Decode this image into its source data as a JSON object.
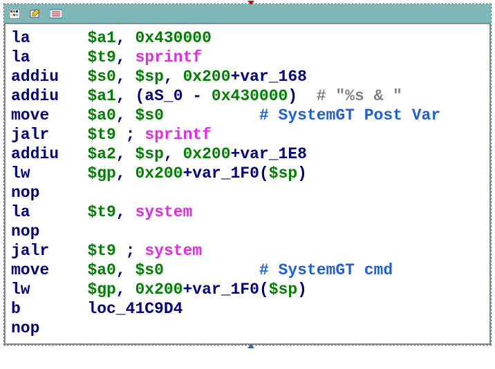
{
  "icons": [
    "palette-icon",
    "edit-icon",
    "list-icon"
  ],
  "code": {
    "lines": [
      {
        "mnemonic": "la",
        "sp": "      ",
        "tokens": [
          {
            "t": "$a1",
            "c": "reg"
          },
          {
            "t": ", ",
            "c": "punct"
          },
          {
            "t": "0x430000",
            "c": "num"
          }
        ]
      },
      {
        "mnemonic": "la",
        "sp": "      ",
        "tokens": [
          {
            "t": "$t9",
            "c": "reg"
          },
          {
            "t": ", ",
            "c": "punct"
          },
          {
            "t": "sprintf",
            "c": "func"
          }
        ]
      },
      {
        "mnemonic": "addiu",
        "sp": "   ",
        "tokens": [
          {
            "t": "$s0",
            "c": "reg"
          },
          {
            "t": ", ",
            "c": "punct"
          },
          {
            "t": "$sp",
            "c": "reg"
          },
          {
            "t": ", ",
            "c": "punct"
          },
          {
            "t": "0x200",
            "c": "num"
          },
          {
            "t": "+",
            "c": "ident"
          },
          {
            "t": "var_168",
            "c": "ident"
          }
        ]
      },
      {
        "mnemonic": "addiu",
        "sp": "   ",
        "tokens": [
          {
            "t": "$a1",
            "c": "reg"
          },
          {
            "t": ", (",
            "c": "punct"
          },
          {
            "t": "aS_0",
            "c": "ident"
          },
          {
            "t": " - ",
            "c": "ident"
          },
          {
            "t": "0x430000",
            "c": "num"
          },
          {
            "t": ")  ",
            "c": "punct"
          },
          {
            "t": "# \"%s & \"",
            "c": "comment"
          }
        ]
      },
      {
        "mnemonic": "move",
        "sp": "    ",
        "tokens": [
          {
            "t": "$a0",
            "c": "reg"
          },
          {
            "t": ", ",
            "c": "punct"
          },
          {
            "t": "$s0",
            "c": "reg"
          },
          {
            "t": "          ",
            "c": "punct"
          },
          {
            "t": "# SystemGT Post Var",
            "c": "comment2"
          }
        ]
      },
      {
        "mnemonic": "jalr",
        "sp": "    ",
        "tokens": [
          {
            "t": "$t9",
            "c": "reg"
          },
          {
            "t": " ; ",
            "c": "ident"
          },
          {
            "t": "sprintf",
            "c": "func"
          }
        ]
      },
      {
        "mnemonic": "addiu",
        "sp": "   ",
        "tokens": [
          {
            "t": "$a2",
            "c": "reg"
          },
          {
            "t": ", ",
            "c": "punct"
          },
          {
            "t": "$sp",
            "c": "reg"
          },
          {
            "t": ", ",
            "c": "punct"
          },
          {
            "t": "0x200",
            "c": "num"
          },
          {
            "t": "+",
            "c": "ident"
          },
          {
            "t": "var_1E8",
            "c": "ident"
          }
        ]
      },
      {
        "mnemonic": "lw",
        "sp": "      ",
        "tokens": [
          {
            "t": "$gp",
            "c": "reg"
          },
          {
            "t": ", ",
            "c": "punct"
          },
          {
            "t": "0x200",
            "c": "num"
          },
          {
            "t": "+",
            "c": "ident"
          },
          {
            "t": "var_1F0",
            "c": "ident"
          },
          {
            "t": "(",
            "c": "punct"
          },
          {
            "t": "$sp",
            "c": "reg"
          },
          {
            "t": ")",
            "c": "punct"
          }
        ]
      },
      {
        "mnemonic": "nop",
        "sp": "",
        "tokens": []
      },
      {
        "mnemonic": "la",
        "sp": "      ",
        "tokens": [
          {
            "t": "$t9",
            "c": "reg"
          },
          {
            "t": ", ",
            "c": "punct"
          },
          {
            "t": "system",
            "c": "func"
          }
        ]
      },
      {
        "mnemonic": "nop",
        "sp": "",
        "tokens": []
      },
      {
        "mnemonic": "jalr",
        "sp": "    ",
        "tokens": [
          {
            "t": "$t9",
            "c": "reg"
          },
          {
            "t": " ; ",
            "c": "ident"
          },
          {
            "t": "system",
            "c": "func"
          }
        ]
      },
      {
        "mnemonic": "move",
        "sp": "    ",
        "tokens": [
          {
            "t": "$a0",
            "c": "reg"
          },
          {
            "t": ", ",
            "c": "punct"
          },
          {
            "t": "$s0",
            "c": "reg"
          },
          {
            "t": "          ",
            "c": "punct"
          },
          {
            "t": "# SystemGT cmd",
            "c": "comment2"
          }
        ]
      },
      {
        "mnemonic": "lw",
        "sp": "      ",
        "tokens": [
          {
            "t": "$gp",
            "c": "reg"
          },
          {
            "t": ", ",
            "c": "punct"
          },
          {
            "t": "0x200",
            "c": "num"
          },
          {
            "t": "+",
            "c": "ident"
          },
          {
            "t": "var_1F0",
            "c": "ident"
          },
          {
            "t": "(",
            "c": "punct"
          },
          {
            "t": "$sp",
            "c": "reg"
          },
          {
            "t": ")",
            "c": "punct"
          }
        ]
      },
      {
        "mnemonic": "b",
        "sp": "       ",
        "tokens": [
          {
            "t": "loc_41C9D4",
            "c": "ident"
          }
        ]
      },
      {
        "mnemonic": "nop",
        "sp": "",
        "tokens": []
      }
    ]
  }
}
